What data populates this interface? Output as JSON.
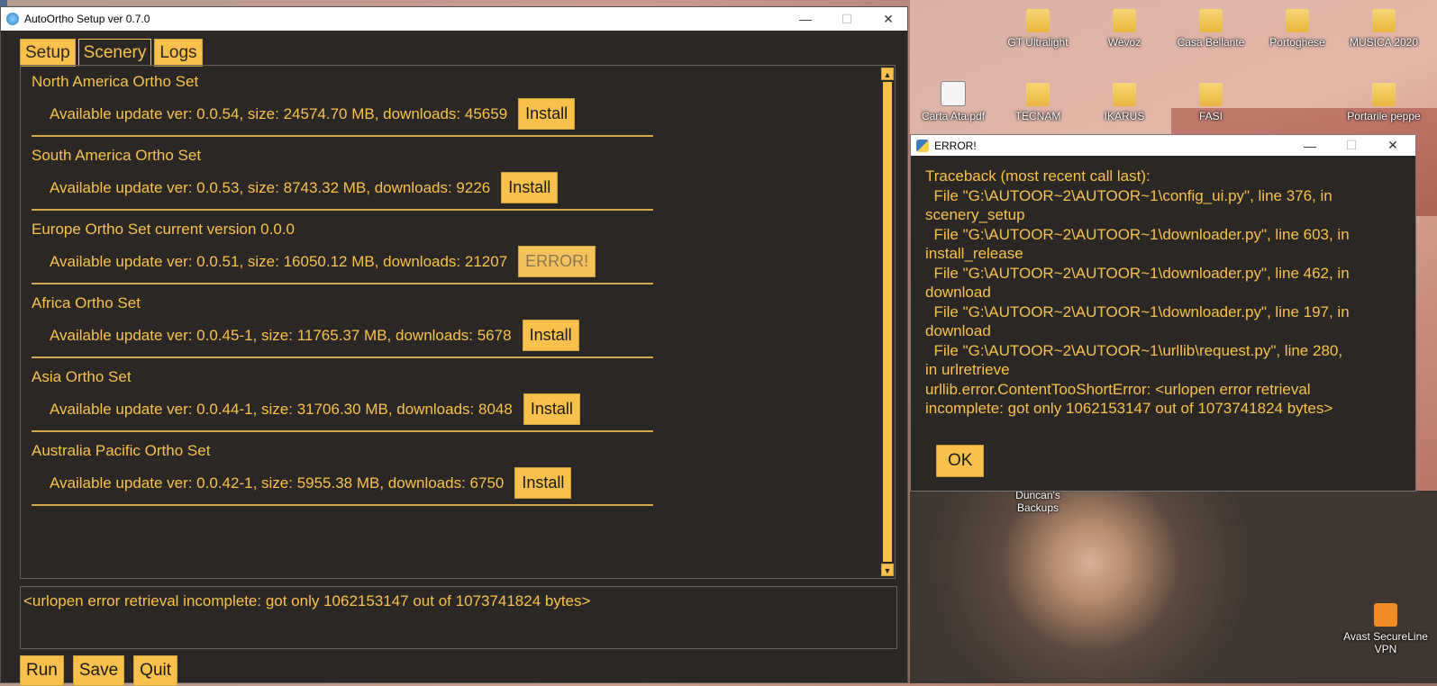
{
  "desktop": {
    "icons": [
      {
        "label": "GT Ultralight",
        "kind": "folder"
      },
      {
        "label": "Wevoz",
        "kind": "folder"
      },
      {
        "label": "Casa Bellante",
        "kind": "folder"
      },
      {
        "label": "Portoghese",
        "kind": "folder"
      },
      {
        "label": "MUSICA 2020",
        "kind": "folder"
      },
      {
        "label": "Carta Ata.pdf",
        "kind": "doc"
      },
      {
        "label": "TECNAM",
        "kind": "folder"
      },
      {
        "label": "IKARUS",
        "kind": "folder"
      },
      {
        "label": "FASI",
        "kind": "folder"
      },
      {
        "label": "Portarile peppe",
        "kind": "folder"
      },
      {
        "label": "Duncan's Backups",
        "kind": "folder"
      },
      {
        "label": "Avast SecureLine VPN",
        "kind": "vpn"
      }
    ]
  },
  "window": {
    "title": "AutoOrtho Setup ver 0.7.0",
    "controls": {
      "minimize": "—",
      "maximize": "☐",
      "close": "✕"
    }
  },
  "tabs": [
    {
      "label": "Setup",
      "active": false
    },
    {
      "label": "Scenery",
      "active": true
    },
    {
      "label": "Logs",
      "active": false
    }
  ],
  "scenery": [
    {
      "title": "North America Ortho Set",
      "info": "Available update ver: 0.0.54, size: 24574.70 MB, downloads: 45659",
      "button": "Install",
      "disabled": false
    },
    {
      "title": "South America Ortho Set",
      "info": "Available update ver: 0.0.53, size: 8743.32 MB, downloads: 9226",
      "button": "Install",
      "disabled": false
    },
    {
      "title": "Europe Ortho Set current version 0.0.0",
      "info": "Available update ver: 0.0.51, size: 16050.12 MB, downloads: 21207",
      "button": "ERROR!",
      "disabled": true
    },
    {
      "title": "Africa Ortho Set",
      "info": "Available update ver: 0.0.45-1, size: 11765.37 MB, downloads: 5678",
      "button": "Install",
      "disabled": false
    },
    {
      "title": "Asia Ortho Set",
      "info": "Available update ver: 0.0.44-1, size: 31706.30 MB, downloads: 8048",
      "button": "Install",
      "disabled": false
    },
    {
      "title": "Australia Pacific Ortho Set",
      "info": "Available update ver: 0.0.42-1, size: 5955.38 MB, downloads: 6750",
      "button": "Install",
      "disabled": false
    }
  ],
  "status_message": "<urlopen error retrieval incomplete: got only 1062153147 out of 1073741824 bytes>",
  "bottom_buttons": {
    "run": "Run",
    "save": "Save",
    "quit": "Quit"
  },
  "error_dialog": {
    "title": "ERROR!",
    "text": "Traceback (most recent call last):\n  File \"G:\\AUTOOR~2\\AUTOOR~1\\config_ui.py\", line 376, in\nscenery_setup\n  File \"G:\\AUTOOR~2\\AUTOOR~1\\downloader.py\", line 603, in\ninstall_release\n  File \"G:\\AUTOOR~2\\AUTOOR~1\\downloader.py\", line 462, in\ndownload\n  File \"G:\\AUTOOR~2\\AUTOOR~1\\downloader.py\", line 197, in\ndownload\n  File \"G:\\AUTOOR~2\\AUTOOR~1\\urllib\\request.py\", line 280,\nin urlretrieve\nurllib.error.ContentTooShortError: <urlopen error retrieval\nincomplete: got only 1062153147 out of 1073741824 bytes>",
    "ok": "OK"
  },
  "colors": {
    "accent": "#f9c14c",
    "background": "#2b2724"
  }
}
